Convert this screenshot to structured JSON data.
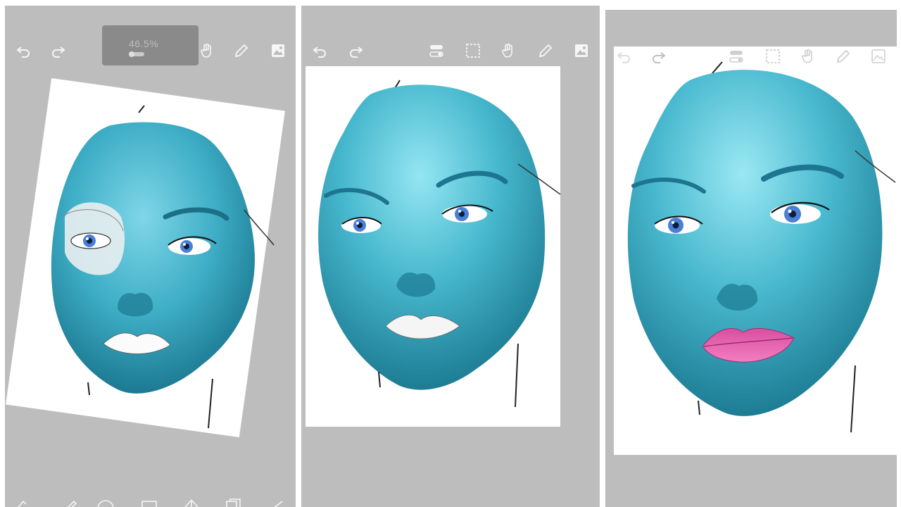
{
  "panels": [
    {
      "id": "p1",
      "zoom_label": "46.5%"
    },
    {
      "id": "p2"
    },
    {
      "id": "p3"
    }
  ],
  "icons": {
    "toolbar": [
      "undo-icon",
      "redo-icon",
      "layer-toggle-icon",
      "selection-icon",
      "hand-icon",
      "pen-icon",
      "image-icon"
    ],
    "bottom": [
      "brush-settings-icon",
      "pencil-icon",
      "ellipse-icon",
      "rectangle-icon",
      "arrow-icon",
      "layers-icon",
      "line-icon"
    ]
  },
  "colors": {
    "background_gray": "#bdbdbd",
    "skin_light": "#8fe2ef",
    "skin_mid": "#45b6cc",
    "skin_dark": "#1e7f96",
    "eye_blue": "#4a7fd6",
    "lip_pink": "#e35aa8"
  }
}
